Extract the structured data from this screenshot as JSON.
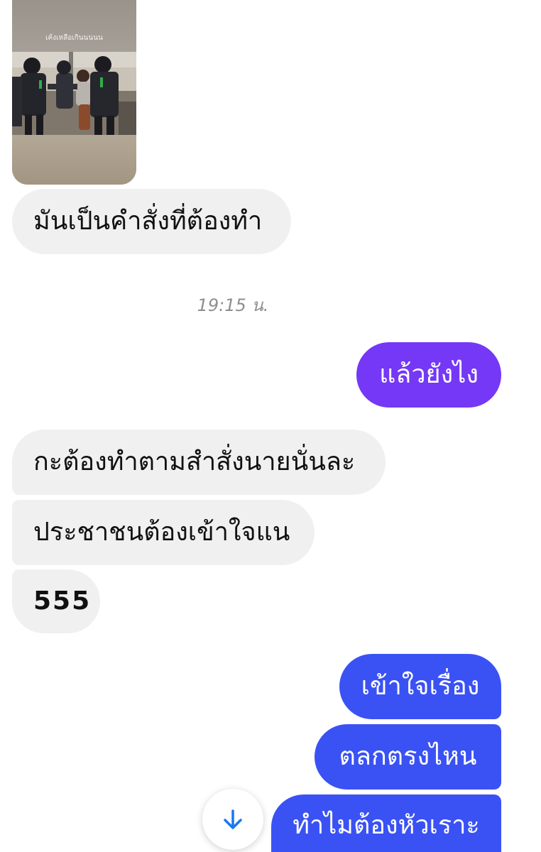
{
  "story_reply": {
    "caption": "เค้งเหลือเกินนนนน"
  },
  "messages": {
    "m1": "มันเป็นคำสั่งที่ต้องทำ",
    "time": "19:15 น.",
    "m2": "แล้วยังไง",
    "m3": "กะต้องทำตามสำสั่งนายนั่นละ",
    "m4": "ประชาชนต้องเข้าใจแน",
    "m5": "555",
    "m6": "เข้าใจเรื่อง",
    "m7": "ตลกตรงไหน",
    "m8": "ทำไมต้องหัวเราะ"
  },
  "colors": {
    "incoming_bubble": "#f0f0f0",
    "outgoing_purple": "#7538f6",
    "outgoing_blue": "#3a52f4",
    "scroll_arrow": "#1877f2"
  },
  "icons": {
    "scroll_down": "arrow-down-icon"
  }
}
